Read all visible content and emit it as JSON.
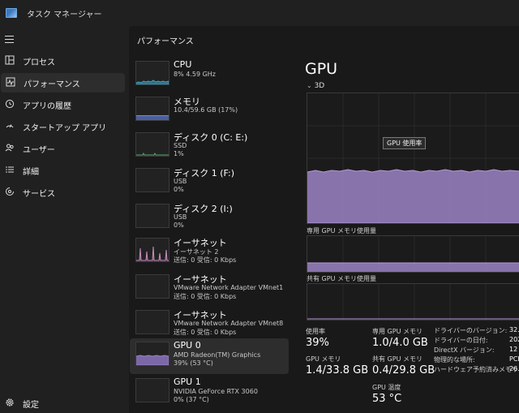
{
  "window": {
    "title": "タスク マネージャー"
  },
  "sidebar": {
    "items": [
      {
        "label": "プロセス",
        "icon": "processes-icon"
      },
      {
        "label": "パフォーマンス",
        "icon": "performance-icon"
      },
      {
        "label": "アプリの履歴",
        "icon": "history-icon"
      },
      {
        "label": "スタートアップ アプリ",
        "icon": "startup-icon"
      },
      {
        "label": "ユーザー",
        "icon": "users-icon"
      },
      {
        "label": "詳細",
        "icon": "details-icon"
      },
      {
        "label": "サービス",
        "icon": "services-icon"
      }
    ],
    "settings_label": "設定"
  },
  "main": {
    "page_title": "パフォーマンス"
  },
  "devices": [
    {
      "name": "CPU",
      "line1": "8%  4.59 GHz",
      "line2": ""
    },
    {
      "name": "メモリ",
      "line1": "10.4/59.6 GB (17%)",
      "line2": ""
    },
    {
      "name": "ディスク 0 (C: E:)",
      "line1": "SSD",
      "line2": "1%"
    },
    {
      "name": "ディスク 1 (F:)",
      "line1": "USB",
      "line2": "0%"
    },
    {
      "name": "ディスク 2 (I:)",
      "line1": "USB",
      "line2": "0%"
    },
    {
      "name": "イーサネット",
      "line1": "イーサネット 2",
      "line2": "送信: 0 受信: 0 Kbps"
    },
    {
      "name": "イーサネット",
      "line1": "VMware Network Adapter VMnet1",
      "line2": "送信: 0 受信: 0 Kbps"
    },
    {
      "name": "イーサネット",
      "line1": "VMware Network Adapter VMnet8",
      "line2": "送信: 0 受信: 0 Kbps"
    },
    {
      "name": "GPU 0",
      "line1": "AMD Radeon(TM) Graphics",
      "line2": "39% (53 °C)"
    },
    {
      "name": "GPU 1",
      "line1": "NVIDIA GeForce RTX 3060",
      "line2": "0% (37 °C)"
    }
  ],
  "detail": {
    "title": "GPU",
    "engine": "3D",
    "tooltip": "GPU 使用率",
    "dedicated_label": "専用 GPU メモリ使用量",
    "shared_label": "共有 GPU メモリ使用量",
    "stats": {
      "usage_label": "使用率",
      "usage_value": "39%",
      "dedicated_label": "専用 GPU メモリ",
      "dedicated_value": "1.0/4.0 GB",
      "gpumem_label": "GPU メモリ",
      "gpumem_value": "1.4/33.8 GB",
      "shared_label": "共有 GPU メモリ",
      "shared_value": "0.4/29.8 GB",
      "temp_label": "GPU 温度",
      "temp_value": "53 °C"
    },
    "props": [
      {
        "label": "ドライバーのバージョン:",
        "value": "32."
      },
      {
        "label": "ドライバーの日付:",
        "value": "202"
      },
      {
        "label": "DirectX バージョン:",
        "value": "12 ("
      },
      {
        "label": "物理的な場所:",
        "value": "PCI"
      },
      {
        "label": "ハードウェア予約済みメモリ:",
        "value": "26.3"
      }
    ]
  },
  "colors": {
    "accent_cpu": "#3aa9c9",
    "accent_mem": "#6a8fd6",
    "accent_net": "#c78fbd",
    "accent_gpu": "#9b82c4"
  }
}
